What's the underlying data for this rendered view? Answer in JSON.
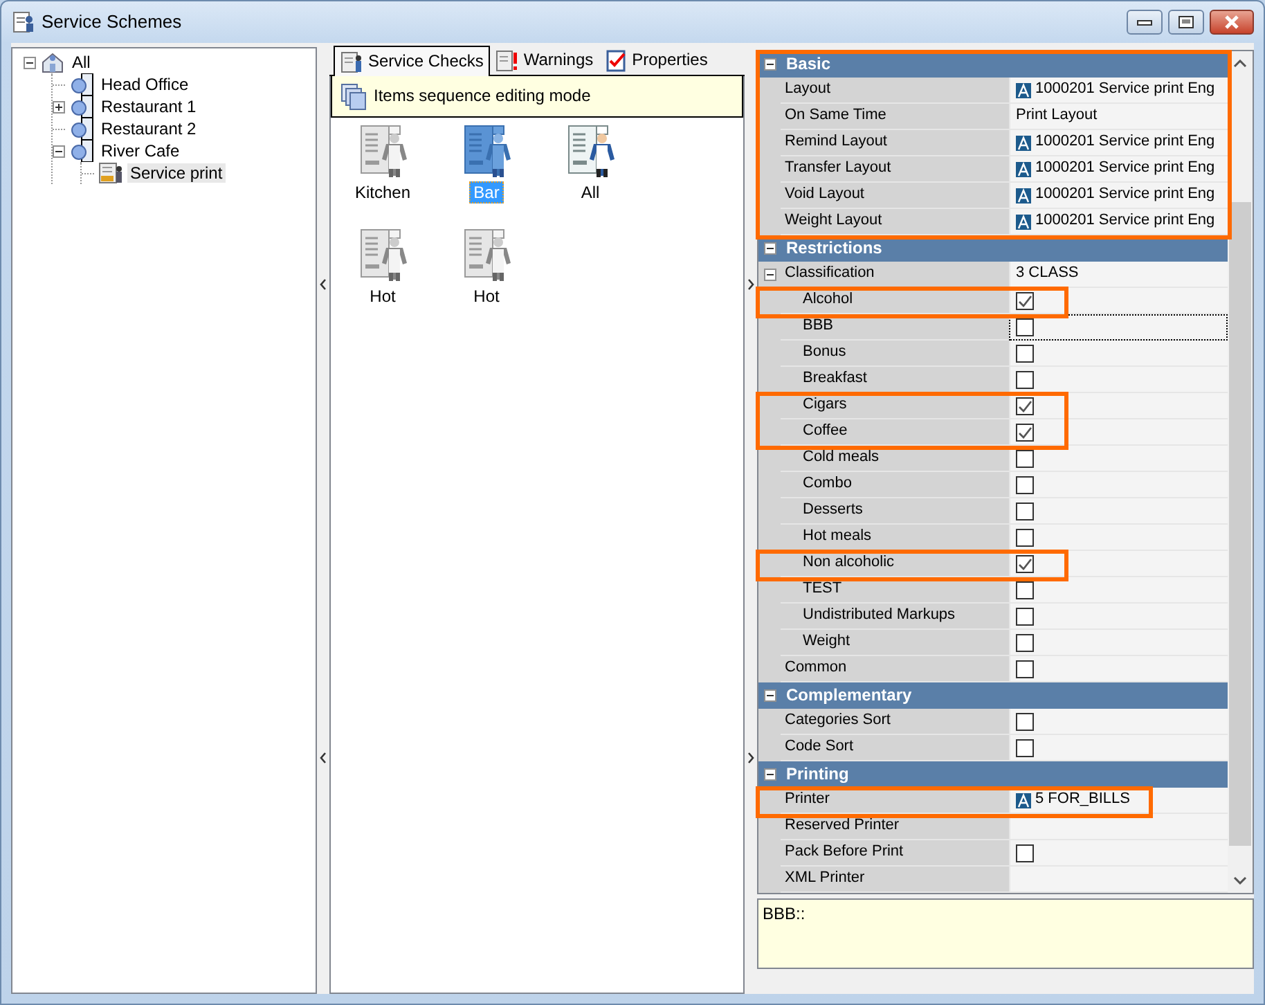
{
  "window": {
    "title": "Service Schemes"
  },
  "tree": [
    {
      "label": "All",
      "kind": "root",
      "expanded": true,
      "selected": false,
      "children": [
        {
          "label": "Head Office",
          "kind": "site",
          "selected": false
        },
        {
          "label": "Restaurant 1",
          "kind": "site",
          "expanded": false,
          "selected": false
        },
        {
          "label": "Restaurant 2",
          "kind": "site",
          "selected": false
        },
        {
          "label": "River Cafe",
          "kind": "site",
          "expanded": true,
          "selected": false,
          "children": [
            {
              "label": "Service print",
              "kind": "scheme",
              "selected": true
            }
          ]
        }
      ]
    }
  ],
  "tabs": [
    {
      "label": "Service Checks",
      "kind": "checks",
      "selected": true
    },
    {
      "label": "Warnings",
      "kind": "warnings",
      "selected": false
    },
    {
      "label": "Properties",
      "kind": "properties",
      "selected": false
    }
  ],
  "banner": {
    "text": "Items sequence editing mode"
  },
  "checks": [
    {
      "label": "Kitchen",
      "selected": false,
      "greyed": true
    },
    {
      "label": "Bar",
      "selected": true,
      "greyed": false
    },
    {
      "label": "All",
      "selected": false,
      "greyed": false
    },
    {
      "label": "Hot",
      "selected": false,
      "greyed": true
    },
    {
      "label": "Hot",
      "selected": false,
      "greyed": true
    }
  ],
  "properties": [
    {
      "category": "Basic",
      "expanded": true,
      "highlighted": true,
      "rows": [
        {
          "name": "Layout",
          "kind": "layout",
          "value": "1000201 Service print Eng"
        },
        {
          "name": "On Same Time",
          "kind": "text",
          "value": "Print Layout"
        },
        {
          "name": "Remind Layout",
          "kind": "layout",
          "value": "1000201 Service print Eng"
        },
        {
          "name": "Transfer Layout",
          "kind": "layout",
          "value": "1000201 Service print Eng"
        },
        {
          "name": "Void Layout",
          "kind": "layout",
          "value": "1000201 Service print Eng"
        },
        {
          "name": "Weight Layout",
          "kind": "layout",
          "value": "1000201 Service print Eng"
        }
      ]
    },
    {
      "category": "Restrictions",
      "expanded": true,
      "highlighted": false,
      "rows": [
        {
          "name": "Classification",
          "kind": "text",
          "value": "3 CLASS",
          "expanded": true,
          "children": [
            {
              "name": "Alcohol",
              "kind": "check",
              "checked": true,
              "highlighted": true
            },
            {
              "name": "BBB",
              "kind": "check",
              "checked": false,
              "focused": true
            },
            {
              "name": "Bonus",
              "kind": "check",
              "checked": false
            },
            {
              "name": "Breakfast",
              "kind": "check",
              "checked": false
            },
            {
              "name": "Cigars",
              "kind": "check",
              "checked": true,
              "highlighted": true
            },
            {
              "name": "Coffee",
              "kind": "check",
              "checked": true,
              "highlighted": true
            },
            {
              "name": "Cold meals",
              "kind": "check",
              "checked": false
            },
            {
              "name": "Combo",
              "kind": "check",
              "checked": false
            },
            {
              "name": "Desserts",
              "kind": "check",
              "checked": false
            },
            {
              "name": "Hot meals",
              "kind": "check",
              "checked": false
            },
            {
              "name": "Non alcoholic",
              "kind": "check",
              "checked": true,
              "highlighted": true
            },
            {
              "name": "TEST",
              "kind": "check",
              "checked": false
            },
            {
              "name": "Undistributed Markups",
              "kind": "check",
              "checked": false
            },
            {
              "name": "Weight",
              "kind": "check",
              "checked": false
            }
          ]
        },
        {
          "name": "Common",
          "kind": "check",
          "checked": false
        }
      ]
    },
    {
      "category": "Complementary",
      "expanded": true,
      "highlighted": false,
      "rows": [
        {
          "name": "Categories Sort",
          "kind": "check",
          "checked": false
        },
        {
          "name": "Code Sort",
          "kind": "check",
          "checked": false
        }
      ]
    },
    {
      "category": "Printing",
      "expanded": true,
      "highlighted": false,
      "rows": [
        {
          "name": "Printer",
          "kind": "layout",
          "value": "5 FOR_BILLS",
          "highlighted": true
        },
        {
          "name": "Reserved Printer",
          "kind": "empty"
        },
        {
          "name": "Pack Before Print",
          "kind": "check",
          "checked": false
        },
        {
          "name": "XML Printer",
          "kind": "empty"
        }
      ]
    }
  ],
  "description": "BBB::"
}
